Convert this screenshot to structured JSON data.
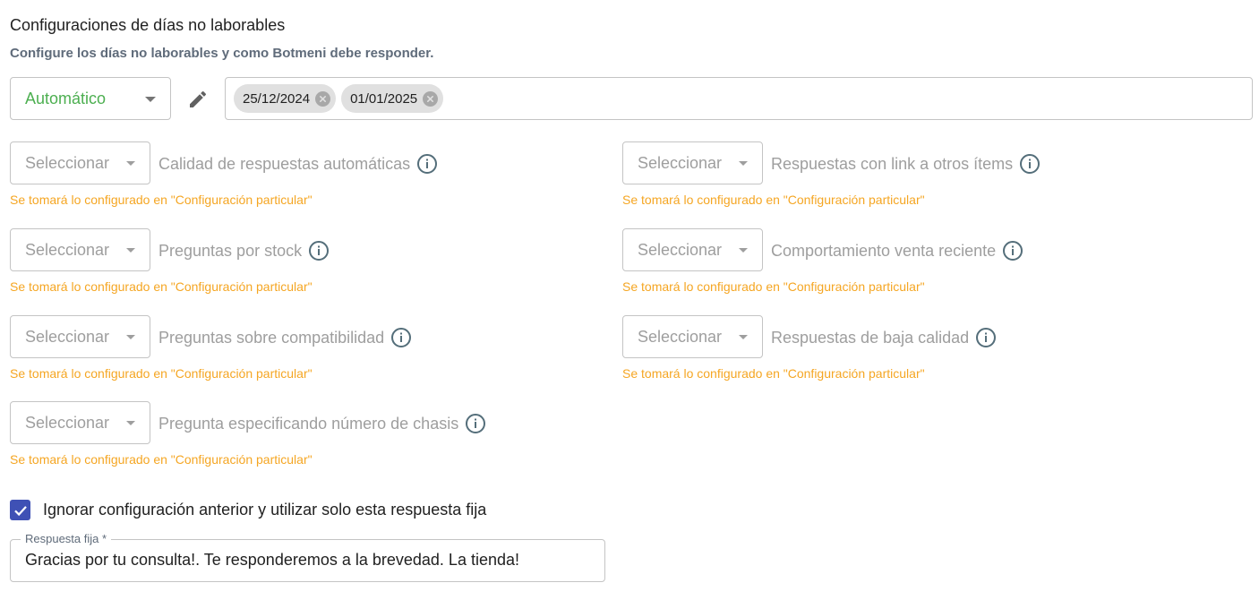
{
  "header": {
    "title": "Configuraciones de días no laborables",
    "subtitle": "Configure los días no laborables y como Botmeni debe responder."
  },
  "mode": {
    "value": "Automático",
    "color": "#4caf50"
  },
  "dates": [
    {
      "label": "25/12/2024"
    },
    {
      "label": "01/01/2025"
    }
  ],
  "settings": [
    {
      "placeholder": "Seleccionar",
      "label": "Calidad de respuestas automáticas",
      "note": "Se tomará lo configurado en \"Configuración particular\""
    },
    {
      "placeholder": "Seleccionar",
      "label": "Respuestas con link a otros ítems",
      "note": "Se tomará lo configurado en \"Configuración particular\""
    },
    {
      "placeholder": "Seleccionar",
      "label": "Preguntas por stock",
      "note": "Se tomará lo configurado en \"Configuración particular\""
    },
    {
      "placeholder": "Seleccionar",
      "label": "Comportamiento venta reciente",
      "note": "Se tomará lo configurado en \"Configuración particular\""
    },
    {
      "placeholder": "Seleccionar",
      "label": "Preguntas sobre compatibilidad",
      "note": "Se tomará lo configurado en \"Configuración particular\""
    },
    {
      "placeholder": "Seleccionar",
      "label": "Respuestas de baja calidad",
      "note": "Se tomará lo configurado en \"Configuración particular\""
    },
    {
      "placeholder": "Seleccionar",
      "label": "Pregunta especificando número de chasis",
      "note": "Se tomará lo configurado en \"Configuración particular\""
    }
  ],
  "ignore": {
    "checked": true,
    "label": "Ignorar configuración anterior y utilizar solo esta respuesta fija"
  },
  "fixed_response": {
    "legend": "Respuesta fija *",
    "value": "Gracias por tu consulta!. Te responderemos a la brevedad. La tienda!"
  },
  "colors": {
    "accent": "#3f51b5",
    "warning": "#f5a623",
    "success": "#4caf50"
  }
}
